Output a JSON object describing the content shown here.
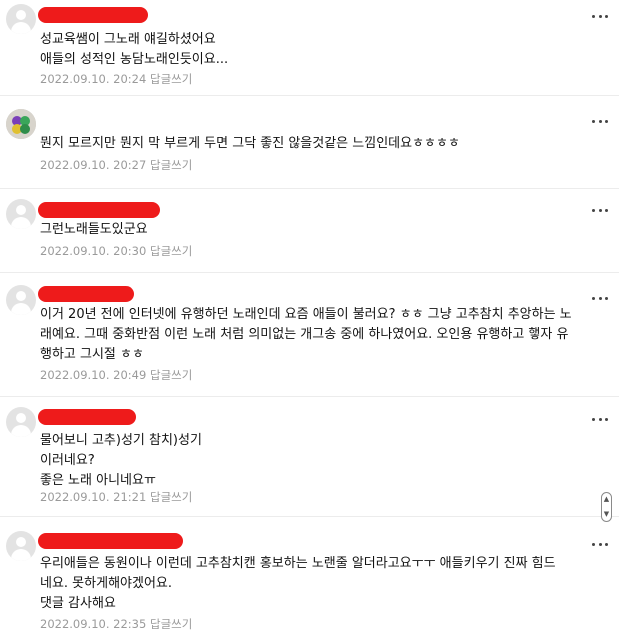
{
  "comments": [
    {
      "author": "redacted-user-1",
      "text": "성교육쌤이 그노래 얘길하셨어요\n애들의 성적인 농담노래인듯이요...",
      "date": "2022.09.10. 20:24",
      "reply_label": "답글쓰기"
    },
    {
      "author": "",
      "text": "뭔지 모르지만 뭔지 막 부르게 두면 그닥 좋진 않을것같은 느낌인데요ㅎㅎㅎㅎ",
      "date": "2022.09.10. 20:27",
      "reply_label": "답글쓰기"
    },
    {
      "author": "redacted-user-3",
      "text": "그런노래들도있군요",
      "date": "2022.09.10. 20:30",
      "reply_label": "답글쓰기"
    },
    {
      "author": "redacted-user-4",
      "text": "이거 20년 전에 인터넷에 유행하던 노래인데 요즘 애들이 불러요? ㅎㅎ 그냥 고추참치 추앙하는 노\n래예요. 그때 중화반점 이런 노래 처럼 의미없는 개그송 중에 하나였어요. 오인용 유행하고 햏자 유\n행하고 그시절 ㅎㅎ",
      "date": "2022.09.10. 20:49",
      "reply_label": "답글쓰기"
    },
    {
      "author": "redacted-user-5",
      "text": "물어보니 고추)성기 참치)성기\n이러네요?\n좋은 노래 아니네요ㅠ",
      "date": "2022.09.10. 21:21",
      "reply_label": "답글쓰기"
    },
    {
      "author": "redacted-user-6",
      "text": "우리애들은 동원이나 이런데 고추참치캔 홍보하는 노랜줄 알더라고요ㅜㅜ 애들키우기 진짜 힘드\n네요. 못하게해야겠어요.\n댓글 감사해요",
      "date": "2022.09.10. 22:35",
      "reply_label": "답글쓰기"
    }
  ],
  "icons": {
    "more": "more-vertical-icon",
    "avatar": "default-avatar-icon",
    "scroll": "scroll-arrows-icon"
  },
  "colors": {
    "redaction": "#ee1b1b",
    "meta_text": "#9a9a9a",
    "divider": "#ececec"
  }
}
